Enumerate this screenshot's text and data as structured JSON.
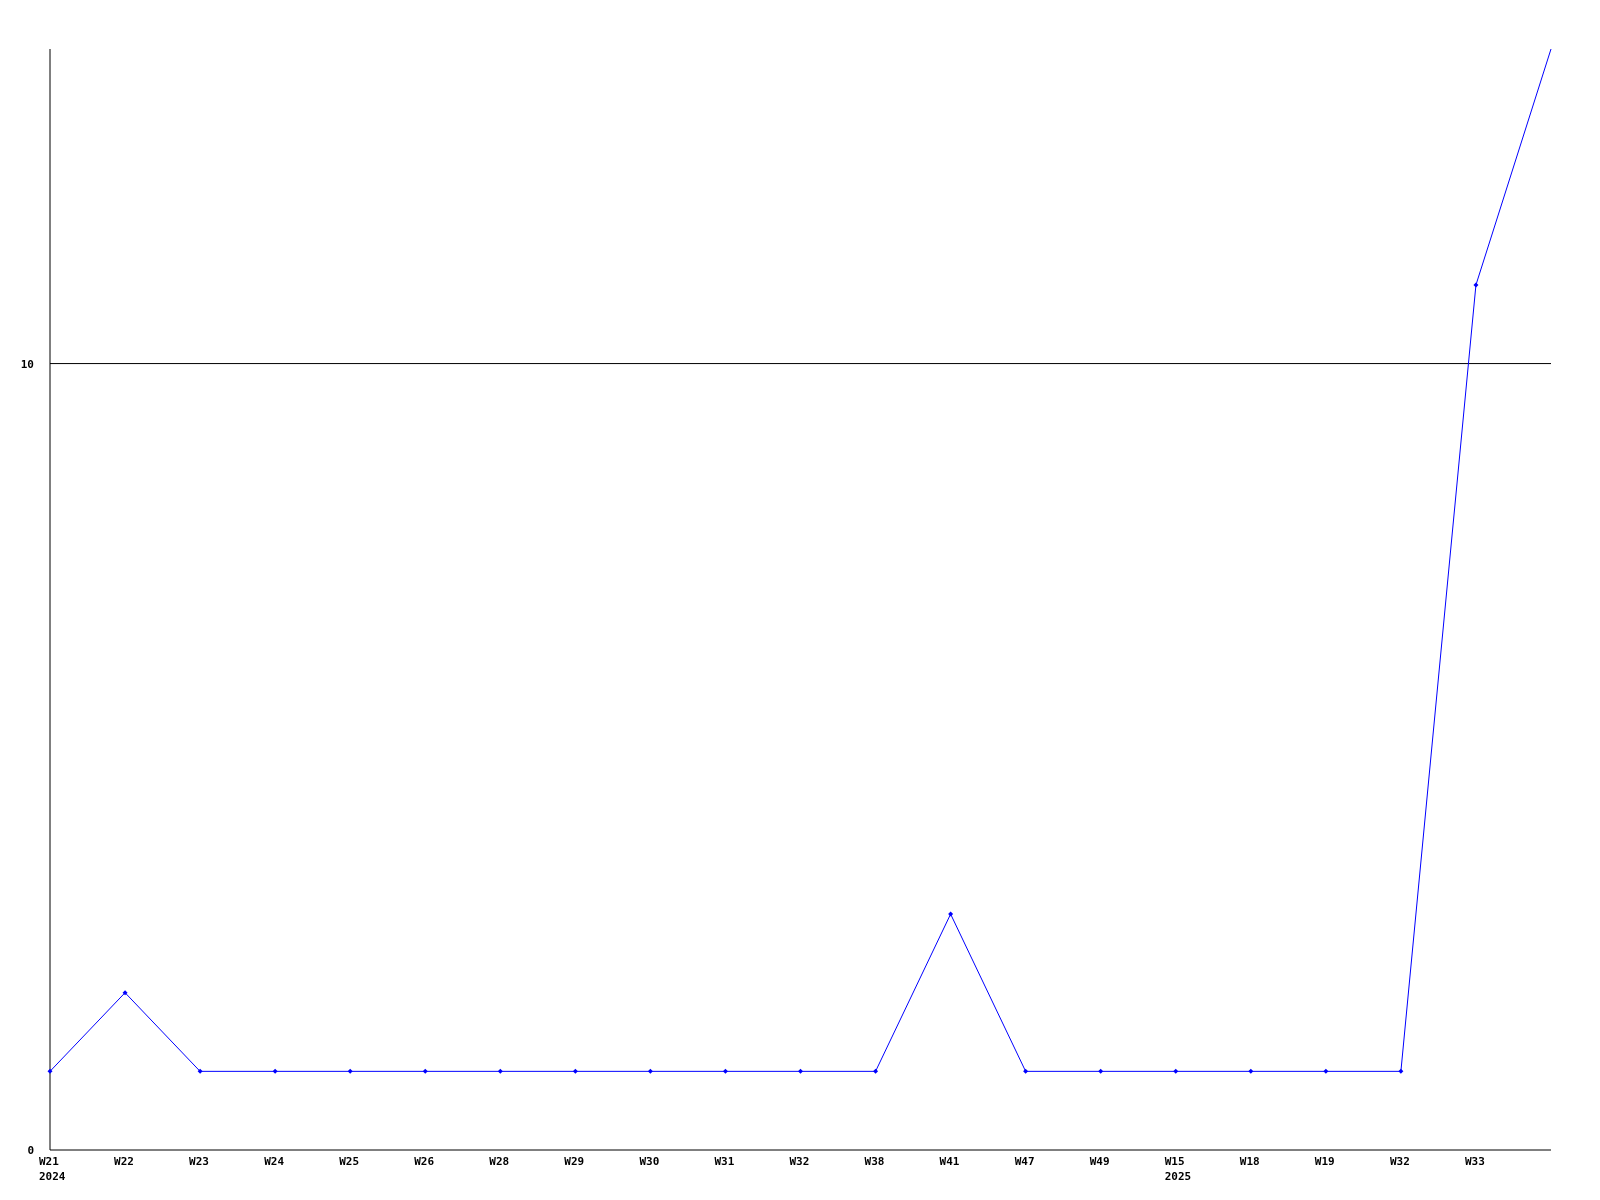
{
  "chart": {
    "chart_data": {
      "type": "line",
      "categories": [
        "W21\n2024",
        "W22",
        "W23",
        "W24",
        "W25",
        "W26",
        "W28",
        "W29",
        "W30",
        "W31",
        "W32",
        "W38",
        "W41",
        "W47",
        "W49",
        "W15\n2025",
        "W18",
        "W19",
        "W32",
        "W33",
        null
      ],
      "series": [
        {
          "color": "#0000ff",
          "marker": "diamond",
          "values": [
            1,
            2,
            1,
            1,
            1,
            1,
            1,
            1,
            1,
            1,
            1,
            1,
            3,
            1,
            1,
            1,
            1,
            1,
            1,
            11,
            14
          ]
        }
      ],
      "ylim": [
        0,
        14
      ],
      "yticks": [
        0,
        10
      ]
    }
  }
}
